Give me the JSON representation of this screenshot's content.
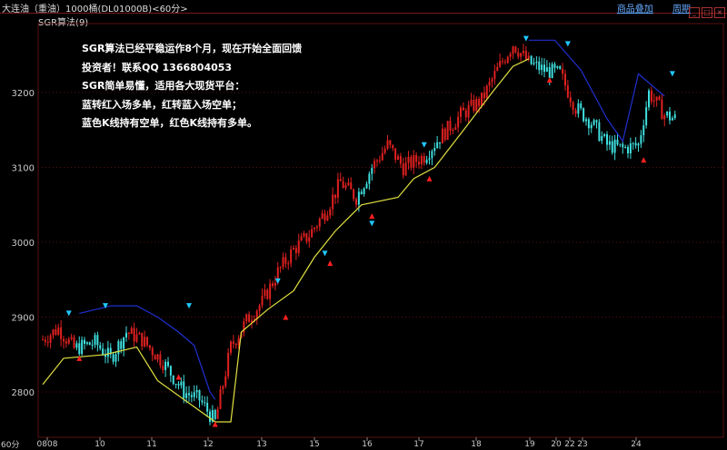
{
  "window": {
    "title": "大连油（重油）1000桶(DL01000B)<60分>",
    "menu": [
      "商品叠加",
      "周期"
    ],
    "controls": [
      "minimize",
      "restore",
      "close"
    ]
  },
  "indicator_label": "SGR算法(9)",
  "annotation_lines": [
    "SGR算法已经平稳运作8个月，现在开始全面回馈",
    "投资者！联系QQ 1366804053",
    "SGR简单易懂，适用各大现货平台：",
    "蓝转红入场多单，红转蓝入场空单；",
    "蓝色K线持有空单，红色K线持有多单。"
  ],
  "corner_label": "60分",
  "colors": {
    "up": "#e02020",
    "down": "#40e0e0",
    "support": "#e0e040",
    "resistance": "#2030d0",
    "grid": "#5a1010",
    "marker_buy": "#ff2020",
    "marker_sell": "#20c8ff"
  },
  "chart_data": {
    "type": "candlestick",
    "period": "60分",
    "y_ticks": [
      2800,
      2900,
      3000,
      3100,
      3200
    ],
    "ylim": [
      2760,
      3285
    ],
    "x_ticks": [
      "0808",
      "10",
      "11",
      "12",
      "13",
      "15",
      "16",
      "17",
      "18",
      "19",
      "20",
      "22",
      "23",
      "24"
    ],
    "anchors": [
      [
        0,
        2870,
        "up"
      ],
      [
        6,
        2885,
        "up"
      ],
      [
        12,
        2858,
        "down"
      ],
      [
        20,
        2866,
        "down"
      ],
      [
        26,
        2845,
        "down"
      ],
      [
        32,
        2880,
        "up"
      ],
      [
        38,
        2870,
        "up"
      ],
      [
        46,
        2840,
        "down"
      ],
      [
        54,
        2800,
        "down"
      ],
      [
        60,
        2790,
        "down"
      ],
      [
        66,
        2760,
        "up"
      ],
      [
        72,
        2860,
        "up"
      ],
      [
        78,
        2895,
        "up"
      ],
      [
        84,
        2920,
        "up"
      ],
      [
        90,
        2960,
        "up"
      ],
      [
        96,
        2990,
        "up"
      ],
      [
        102,
        3010,
        "up"
      ],
      [
        108,
        3040,
        "up"
      ],
      [
        114,
        3080,
        "up"
      ],
      [
        120,
        3060,
        "down"
      ],
      [
        126,
        3100,
        "up"
      ],
      [
        132,
        3130,
        "up"
      ],
      [
        138,
        3100,
        "up"
      ],
      [
        146,
        3115,
        "down"
      ],
      [
        152,
        3140,
        "up"
      ],
      [
        160,
        3170,
        "up"
      ],
      [
        168,
        3190,
        "up"
      ],
      [
        174,
        3230,
        "up"
      ],
      [
        180,
        3265,
        "up"
      ],
      [
        186,
        3240,
        "down"
      ],
      [
        192,
        3230,
        "down"
      ],
      [
        198,
        3225,
        "up"
      ],
      [
        204,
        3180,
        "down"
      ],
      [
        210,
        3160,
        "down"
      ],
      [
        216,
        3130,
        "down"
      ],
      [
        222,
        3125,
        "down"
      ],
      [
        228,
        3130,
        "down"
      ],
      [
        232,
        3200,
        "up"
      ],
      [
        238,
        3170,
        "down"
      ],
      [
        242,
        3165,
        "down"
      ]
    ],
    "support_line": [
      [
        0,
        2810
      ],
      [
        8,
        2845
      ],
      [
        24,
        2850
      ],
      [
        36,
        2860
      ],
      [
        44,
        2815
      ],
      [
        66,
        2760
      ],
      [
        72,
        2760
      ],
      [
        76,
        2880
      ],
      [
        86,
        2910
      ],
      [
        96,
        2935
      ],
      [
        104,
        2980
      ],
      [
        112,
        3015
      ],
      [
        122,
        3050
      ],
      [
        136,
        3060
      ],
      [
        142,
        3085
      ],
      [
        150,
        3100
      ],
      [
        160,
        3145
      ],
      [
        172,
        3200
      ],
      [
        180,
        3235
      ],
      [
        186,
        3245
      ]
    ],
    "resistance_line": [
      [
        14,
        2905
      ],
      [
        26,
        2915
      ],
      [
        36,
        2915
      ],
      [
        44,
        2900
      ],
      [
        52,
        2880
      ],
      [
        58,
        2862
      ],
      [
        64,
        2800
      ],
      [
        66,
        2790
      ],
      [
        186,
        3270
      ],
      [
        196,
        3270
      ],
      [
        206,
        3230
      ],
      [
        216,
        3165
      ],
      [
        222,
        3135
      ],
      [
        228,
        3225
      ],
      [
        238,
        3195
      ]
    ],
    "buy_markers": [
      [
        14,
        2845
      ],
      [
        52,
        2820
      ],
      [
        66,
        2757
      ],
      [
        93,
        2900
      ],
      [
        110,
        2972
      ],
      [
        126,
        3035
      ],
      [
        148,
        3085
      ],
      [
        194,
        3217
      ],
      [
        230,
        3110
      ]
    ],
    "sell_markers": [
      [
        10,
        2905
      ],
      [
        24,
        2915
      ],
      [
        56,
        2915
      ],
      [
        90,
        2948
      ],
      [
        108,
        2985
      ],
      [
        126,
        3025
      ],
      [
        146,
        3130
      ],
      [
        185,
        3272
      ],
      [
        201,
        3265
      ],
      [
        241,
        3225
      ]
    ],
    "n_bars": 243
  }
}
